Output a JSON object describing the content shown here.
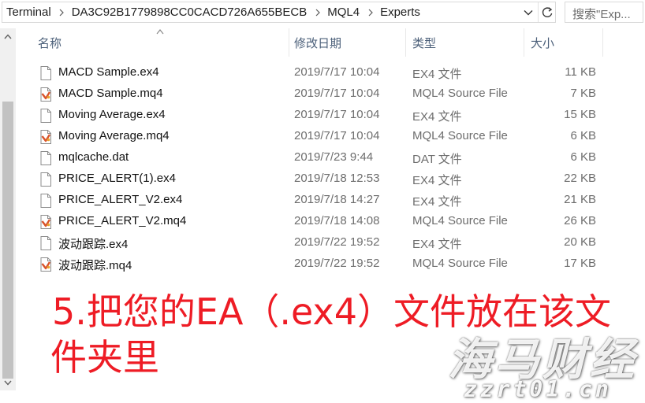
{
  "address": {
    "crumbs": [
      "Terminal",
      "DA3C92B1779898CC0CACD726A655BECB",
      "MQL4",
      "Experts"
    ],
    "search_placeholder": "搜索\"Exp..."
  },
  "columns": {
    "name": "名称",
    "date": "修改日期",
    "type": "类型",
    "size": "大小"
  },
  "files": [
    {
      "name": "MACD Sample.ex4",
      "date": "2019/7/17 10:04",
      "type": "EX4 文件",
      "size": "11 KB",
      "icon": "file-icon"
    },
    {
      "name": "MACD Sample.mq4",
      "date": "2019/7/17 10:04",
      "type": "MQL4 Source File",
      "size": "7 KB",
      "icon": "mql4-source-icon"
    },
    {
      "name": "Moving Average.ex4",
      "date": "2019/7/17 10:04",
      "type": "EX4 文件",
      "size": "15 KB",
      "icon": "file-icon"
    },
    {
      "name": "Moving Average.mq4",
      "date": "2019/7/17 10:04",
      "type": "MQL4 Source File",
      "size": "6 KB",
      "icon": "mql4-source-icon"
    },
    {
      "name": "mqlcache.dat",
      "date": "2019/7/23 9:44",
      "type": "DAT 文件",
      "size": "6 KB",
      "icon": "file-icon"
    },
    {
      "name": "PRICE_ALERT(1).ex4",
      "date": "2019/7/18 12:53",
      "type": "EX4 文件",
      "size": "22 KB",
      "icon": "file-icon"
    },
    {
      "name": "PRICE_ALERT_V2.ex4",
      "date": "2019/7/18 14:27",
      "type": "EX4 文件",
      "size": "21 KB",
      "icon": "file-icon"
    },
    {
      "name": "PRICE_ALERT_V2.mq4",
      "date": "2019/7/18 14:08",
      "type": "MQL4 Source File",
      "size": "26 KB",
      "icon": "mql4-source-icon"
    },
    {
      "name": "波动跟踪.ex4",
      "date": "2019/7/22 19:52",
      "type": "EX4 文件",
      "size": "20 KB",
      "icon": "file-icon"
    },
    {
      "name": "波动跟踪.mq4",
      "date": "2019/7/22 19:52",
      "type": "MQL4 Source File",
      "size": "17 KB",
      "icon": "mql4-source-icon"
    }
  ],
  "annotation": {
    "line1": "5.把您的EA（.ex4）文件放在该文",
    "line2": "件夹里"
  },
  "watermark": {
    "logo": "海马财经",
    "url": "zzrt01.cn"
  },
  "colors": {
    "annotation": "#ee1c25",
    "header_text": "#4c607a",
    "secondary_text": "#6d6d6d"
  }
}
